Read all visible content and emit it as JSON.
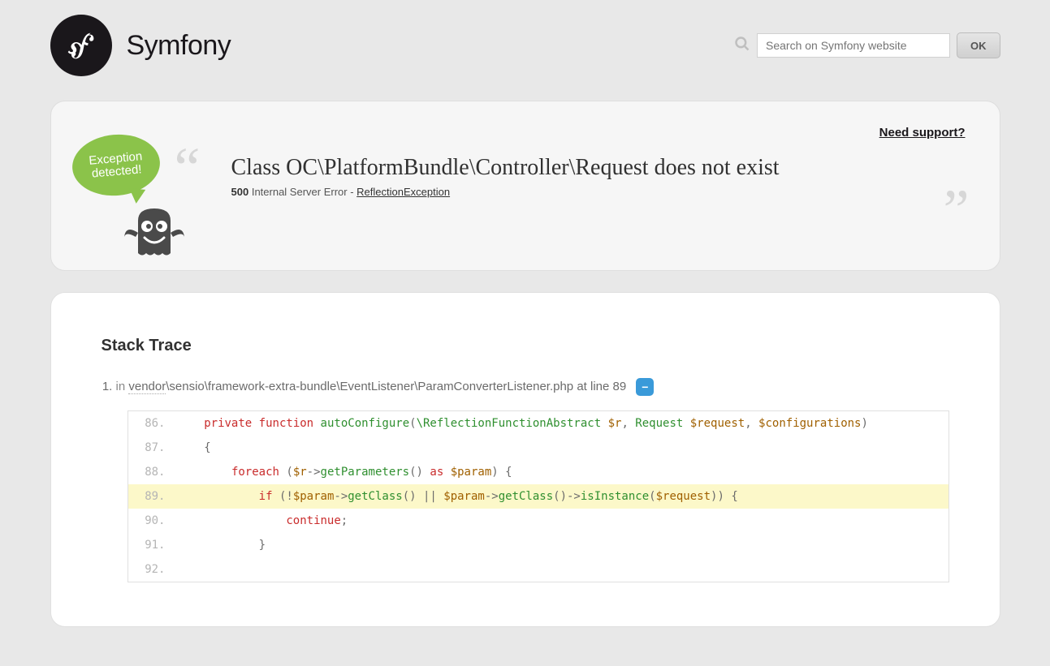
{
  "header": {
    "brand": "Symfony",
    "search_placeholder": "Search on Symfony website",
    "ok_label": "OK"
  },
  "bubble_text": "Exception detected!",
  "support_link": "Need support?",
  "exception": {
    "message": "Class OC\\PlatformBundle\\Controller\\Request does not exist",
    "code": "500",
    "status": "Internal Server Error",
    "exception_class": "ReflectionException"
  },
  "trace": {
    "title": "Stack Trace",
    "item": {
      "in": "in",
      "path_link": "vendor",
      "path_rest": "\\sensio\\framework-extra-bundle\\EventListener\\ParamConverterListener.php",
      "at_line": " at line 89"
    },
    "code_lines": [
      {
        "no": "86.",
        "hl": false,
        "segments": [
          {
            "t": "    ",
            "c": ""
          },
          {
            "t": "private",
            "c": "k-private"
          },
          {
            "t": " ",
            "c": ""
          },
          {
            "t": "function",
            "c": "k-private"
          },
          {
            "t": " ",
            "c": ""
          },
          {
            "t": "autoConfigure",
            "c": "k-func"
          },
          {
            "t": "(",
            "c": ""
          },
          {
            "t": "\\ReflectionFunctionAbstract",
            "c": "k-type"
          },
          {
            "t": " ",
            "c": ""
          },
          {
            "t": "$r",
            "c": "k-var"
          },
          {
            "t": ", ",
            "c": ""
          },
          {
            "t": "Request",
            "c": "k-type"
          },
          {
            "t": " ",
            "c": ""
          },
          {
            "t": "$request",
            "c": "k-var"
          },
          {
            "t": ", ",
            "c": ""
          },
          {
            "t": "$configurations",
            "c": "k-var"
          },
          {
            "t": ")",
            "c": ""
          }
        ]
      },
      {
        "no": "87.",
        "hl": false,
        "segments": [
          {
            "t": "    {",
            "c": ""
          }
        ]
      },
      {
        "no": "88.",
        "hl": false,
        "segments": [
          {
            "t": "        ",
            "c": ""
          },
          {
            "t": "foreach",
            "c": "k-keyword"
          },
          {
            "t": " (",
            "c": ""
          },
          {
            "t": "$r",
            "c": "k-var"
          },
          {
            "t": "->",
            "c": ""
          },
          {
            "t": "getParameters",
            "c": "k-func"
          },
          {
            "t": "() ",
            "c": ""
          },
          {
            "t": "as",
            "c": "k-keyword"
          },
          {
            "t": " ",
            "c": ""
          },
          {
            "t": "$param",
            "c": "k-var"
          },
          {
            "t": ") {",
            "c": ""
          }
        ]
      },
      {
        "no": "89.",
        "hl": true,
        "segments": [
          {
            "t": "            ",
            "c": ""
          },
          {
            "t": "if",
            "c": "k-keyword"
          },
          {
            "t": " (!",
            "c": ""
          },
          {
            "t": "$param",
            "c": "k-var"
          },
          {
            "t": "->",
            "c": ""
          },
          {
            "t": "getClass",
            "c": "k-func"
          },
          {
            "t": "() || ",
            "c": ""
          },
          {
            "t": "$param",
            "c": "k-var"
          },
          {
            "t": "->",
            "c": ""
          },
          {
            "t": "getClass",
            "c": "k-func"
          },
          {
            "t": "()->",
            "c": ""
          },
          {
            "t": "isInstance",
            "c": "k-func"
          },
          {
            "t": "(",
            "c": ""
          },
          {
            "t": "$request",
            "c": "k-var"
          },
          {
            "t": ")) {",
            "c": ""
          }
        ]
      },
      {
        "no": "90.",
        "hl": false,
        "segments": [
          {
            "t": "                ",
            "c": ""
          },
          {
            "t": "continue",
            "c": "k-keyword"
          },
          {
            "t": ";",
            "c": ""
          }
        ]
      },
      {
        "no": "91.",
        "hl": false,
        "segments": [
          {
            "t": "            }",
            "c": ""
          }
        ]
      },
      {
        "no": "92.",
        "hl": false,
        "segments": [
          {
            "t": "",
            "c": ""
          }
        ]
      }
    ]
  }
}
